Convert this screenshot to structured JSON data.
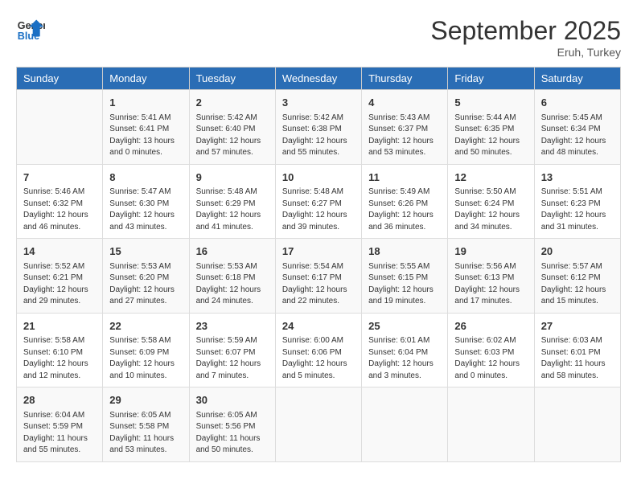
{
  "header": {
    "logo_line1": "General",
    "logo_line2": "Blue",
    "month": "September 2025",
    "location": "Eruh, Turkey"
  },
  "weekdays": [
    "Sunday",
    "Monday",
    "Tuesday",
    "Wednesday",
    "Thursday",
    "Friday",
    "Saturday"
  ],
  "weeks": [
    [
      {
        "day": "",
        "info": ""
      },
      {
        "day": "1",
        "info": "Sunrise: 5:41 AM\nSunset: 6:41 PM\nDaylight: 13 hours\nand 0 minutes."
      },
      {
        "day": "2",
        "info": "Sunrise: 5:42 AM\nSunset: 6:40 PM\nDaylight: 12 hours\nand 57 minutes."
      },
      {
        "day": "3",
        "info": "Sunrise: 5:42 AM\nSunset: 6:38 PM\nDaylight: 12 hours\nand 55 minutes."
      },
      {
        "day": "4",
        "info": "Sunrise: 5:43 AM\nSunset: 6:37 PM\nDaylight: 12 hours\nand 53 minutes."
      },
      {
        "day": "5",
        "info": "Sunrise: 5:44 AM\nSunset: 6:35 PM\nDaylight: 12 hours\nand 50 minutes."
      },
      {
        "day": "6",
        "info": "Sunrise: 5:45 AM\nSunset: 6:34 PM\nDaylight: 12 hours\nand 48 minutes."
      }
    ],
    [
      {
        "day": "7",
        "info": "Sunrise: 5:46 AM\nSunset: 6:32 PM\nDaylight: 12 hours\nand 46 minutes."
      },
      {
        "day": "8",
        "info": "Sunrise: 5:47 AM\nSunset: 6:30 PM\nDaylight: 12 hours\nand 43 minutes."
      },
      {
        "day": "9",
        "info": "Sunrise: 5:48 AM\nSunset: 6:29 PM\nDaylight: 12 hours\nand 41 minutes."
      },
      {
        "day": "10",
        "info": "Sunrise: 5:48 AM\nSunset: 6:27 PM\nDaylight: 12 hours\nand 39 minutes."
      },
      {
        "day": "11",
        "info": "Sunrise: 5:49 AM\nSunset: 6:26 PM\nDaylight: 12 hours\nand 36 minutes."
      },
      {
        "day": "12",
        "info": "Sunrise: 5:50 AM\nSunset: 6:24 PM\nDaylight: 12 hours\nand 34 minutes."
      },
      {
        "day": "13",
        "info": "Sunrise: 5:51 AM\nSunset: 6:23 PM\nDaylight: 12 hours\nand 31 minutes."
      }
    ],
    [
      {
        "day": "14",
        "info": "Sunrise: 5:52 AM\nSunset: 6:21 PM\nDaylight: 12 hours\nand 29 minutes."
      },
      {
        "day": "15",
        "info": "Sunrise: 5:53 AM\nSunset: 6:20 PM\nDaylight: 12 hours\nand 27 minutes."
      },
      {
        "day": "16",
        "info": "Sunrise: 5:53 AM\nSunset: 6:18 PM\nDaylight: 12 hours\nand 24 minutes."
      },
      {
        "day": "17",
        "info": "Sunrise: 5:54 AM\nSunset: 6:17 PM\nDaylight: 12 hours\nand 22 minutes."
      },
      {
        "day": "18",
        "info": "Sunrise: 5:55 AM\nSunset: 6:15 PM\nDaylight: 12 hours\nand 19 minutes."
      },
      {
        "day": "19",
        "info": "Sunrise: 5:56 AM\nSunset: 6:13 PM\nDaylight: 12 hours\nand 17 minutes."
      },
      {
        "day": "20",
        "info": "Sunrise: 5:57 AM\nSunset: 6:12 PM\nDaylight: 12 hours\nand 15 minutes."
      }
    ],
    [
      {
        "day": "21",
        "info": "Sunrise: 5:58 AM\nSunset: 6:10 PM\nDaylight: 12 hours\nand 12 minutes."
      },
      {
        "day": "22",
        "info": "Sunrise: 5:58 AM\nSunset: 6:09 PM\nDaylight: 12 hours\nand 10 minutes."
      },
      {
        "day": "23",
        "info": "Sunrise: 5:59 AM\nSunset: 6:07 PM\nDaylight: 12 hours\nand 7 minutes."
      },
      {
        "day": "24",
        "info": "Sunrise: 6:00 AM\nSunset: 6:06 PM\nDaylight: 12 hours\nand 5 minutes."
      },
      {
        "day": "25",
        "info": "Sunrise: 6:01 AM\nSunset: 6:04 PM\nDaylight: 12 hours\nand 3 minutes."
      },
      {
        "day": "26",
        "info": "Sunrise: 6:02 AM\nSunset: 6:03 PM\nDaylight: 12 hours\nand 0 minutes."
      },
      {
        "day": "27",
        "info": "Sunrise: 6:03 AM\nSunset: 6:01 PM\nDaylight: 11 hours\nand 58 minutes."
      }
    ],
    [
      {
        "day": "28",
        "info": "Sunrise: 6:04 AM\nSunset: 5:59 PM\nDaylight: 11 hours\nand 55 minutes."
      },
      {
        "day": "29",
        "info": "Sunrise: 6:05 AM\nSunset: 5:58 PM\nDaylight: 11 hours\nand 53 minutes."
      },
      {
        "day": "30",
        "info": "Sunrise: 6:05 AM\nSunset: 5:56 PM\nDaylight: 11 hours\nand 50 minutes."
      },
      {
        "day": "",
        "info": ""
      },
      {
        "day": "",
        "info": ""
      },
      {
        "day": "",
        "info": ""
      },
      {
        "day": "",
        "info": ""
      }
    ]
  ]
}
